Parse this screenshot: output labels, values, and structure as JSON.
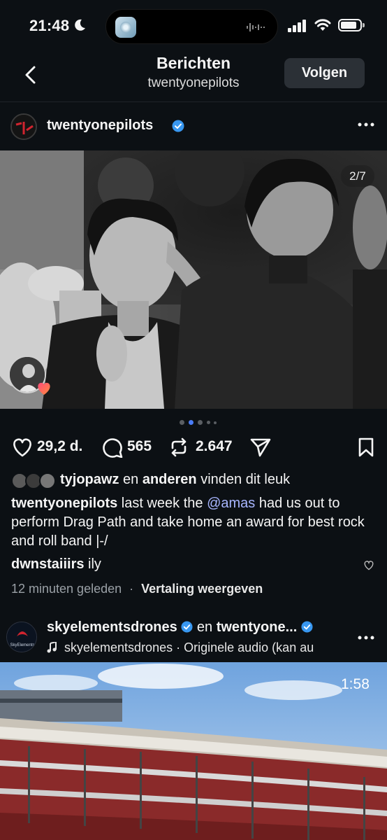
{
  "status_bar": {
    "time": "21:48"
  },
  "header": {
    "title": "Berichten",
    "subtitle": "twentyonepilots",
    "follow_label": "Volgen"
  },
  "post": {
    "username": "twentyonepilots",
    "image_counter": "2/7",
    "carousel": {
      "total": 5,
      "active": 1
    },
    "likes_count": "29,2 d.",
    "comments_count": "565",
    "reposts_count": "2.647",
    "liked_by": {
      "user": "tyjopawz",
      "connector": "en",
      "others": "anderen",
      "suffix": "vinden dit leuk"
    },
    "caption": {
      "user": "twentyonepilots",
      "text_before": "last week the",
      "mention": "@amas",
      "text_after": "had us out to perform Drag Path and take home an award for best rock and roll band |-/"
    },
    "top_comment": {
      "user": "dwnstaiiirs",
      "text": "ily"
    },
    "timestamp": "12 minuten geleden",
    "translate_label": "Vertaling weergeven",
    "separator": "·"
  },
  "next_post": {
    "user1": "skyelementsdrones",
    "connector": "en",
    "user2": "twentyone...",
    "audio_user": "skyelementsdrones",
    "audio_text": "· Originele audio (kan au",
    "video_time": "1:58",
    "avatar_logo_text": "SkyElements"
  },
  "colors": {
    "background": "#0c1014",
    "verified": "#3897f0",
    "mention": "#a8b6ff",
    "active_dot": "#4a7cf7"
  },
  "icons": [
    "moon-icon",
    "signal-icon",
    "wifi-icon",
    "battery-icon",
    "back-chevron-icon",
    "verified-badge-icon",
    "more-icon",
    "heart-icon",
    "comment-icon",
    "repost-icon",
    "share-icon",
    "bookmark-icon",
    "music-note-icon"
  ]
}
